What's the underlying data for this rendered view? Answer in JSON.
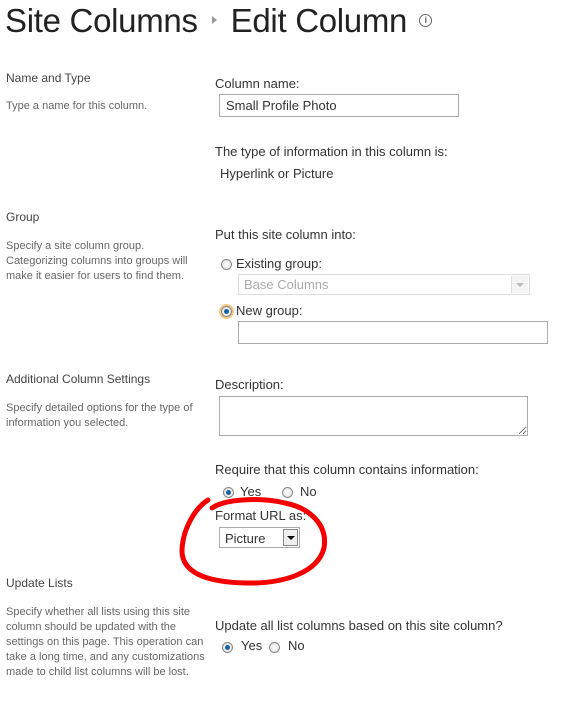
{
  "header": {
    "breadcrumb_parent": "Site Columns",
    "page_title": "Edit Column"
  },
  "sections": {
    "name_type": {
      "heading": "Name and Type",
      "description": "Type a name for this column."
    },
    "group": {
      "heading": "Group",
      "description": "Specify a site column group. Categorizing columns into groups will make it easier for users to find them."
    },
    "additional": {
      "heading": "Additional Column Settings",
      "description": "Specify detailed options for the type of information you selected."
    },
    "update": {
      "heading": "Update Lists",
      "description": "Specify whether all lists using this site column should be updated with the settings on this page. This operation can take a long time, and any customizations made to child list columns will be lost."
    }
  },
  "form": {
    "column_name_label": "Column name:",
    "column_name_value": "Small Profile Photo",
    "type_label": "The type of information in this column is:",
    "type_value": "Hyperlink or Picture",
    "group_label": "Put this site column into:",
    "existing_group_label": "Existing group:",
    "existing_group_value": "Base Columns",
    "new_group_label": "New group:",
    "new_group_value": "",
    "description_label": "Description:",
    "description_value": "",
    "required_label": "Require that this column contains information:",
    "required_yes": "Yes",
    "required_no": "No",
    "format_label": "Format URL as:",
    "format_value": "Picture",
    "update_label": "Update all list columns based on this site column?",
    "update_yes": "Yes",
    "update_no": "No"
  },
  "annotation": {
    "color": "#ff0000"
  }
}
